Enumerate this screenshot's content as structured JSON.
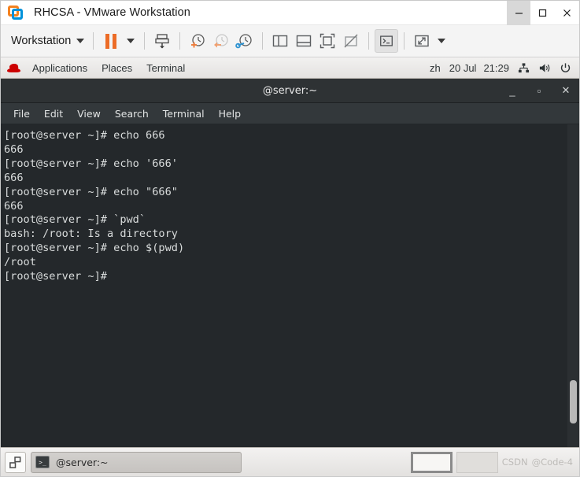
{
  "vmware": {
    "title": "RHCSA - VMware Workstation",
    "logo_icon": "vmware-logo-icon",
    "window_controls": [
      {
        "name": "minimize-button",
        "glyph": "minimize-icon"
      },
      {
        "name": "maximize-button",
        "glyph": "maximize-icon"
      },
      {
        "name": "close-button",
        "glyph": "close-icon"
      }
    ],
    "toolbar": {
      "menu_label": "Workstation",
      "buttons": [
        {
          "name": "pause-button",
          "icon": "pause-icon"
        },
        {
          "name": "pause-dropdown",
          "icon": "chevron-down-icon"
        },
        {
          "name": "power-button",
          "icon": "power-down-icon"
        },
        {
          "name": "take-snapshot-button",
          "icon": "snapshot-add-icon"
        },
        {
          "name": "revert-snapshot-button",
          "icon": "snapshot-revert-icon"
        },
        {
          "name": "snapshot-manager-button",
          "icon": "snapshot-manager-icon"
        },
        {
          "name": "show-library-button",
          "icon": "library-panel-icon"
        },
        {
          "name": "show-thumbnails-button",
          "icon": "thumbnail-bar-icon"
        },
        {
          "name": "full-screen-button",
          "icon": "fullscreen-icon"
        },
        {
          "name": "unity-mode-button",
          "icon": "unity-mode-icon"
        },
        {
          "name": "console-view-button",
          "icon": "console-prompt-icon"
        },
        {
          "name": "stretch-button",
          "icon": "stretch-arrows-icon"
        },
        {
          "name": "stretch-dropdown",
          "icon": "chevron-down-icon"
        }
      ]
    }
  },
  "gnome_topbar": {
    "logo_icon": "redhat-hat-icon",
    "items": [
      {
        "name": "applications-menu",
        "label": "Applications"
      },
      {
        "name": "places-menu",
        "label": "Places"
      },
      {
        "name": "active-app-menu",
        "label": "Terminal"
      }
    ],
    "input_source": "zh",
    "date": "20 Jul",
    "time": "21:29",
    "status_icons": [
      {
        "name": "network-icon"
      },
      {
        "name": "volume-icon"
      },
      {
        "name": "power-icon"
      }
    ]
  },
  "terminal": {
    "title": "@server:~",
    "window_controls": [
      {
        "name": "terminal-minimize-button",
        "glyph": "_"
      },
      {
        "name": "terminal-maximize-button",
        "glyph": "▫"
      },
      {
        "name": "terminal-close-button",
        "glyph": "✕"
      }
    ],
    "menus": [
      {
        "name": "menu-file",
        "label": "File"
      },
      {
        "name": "menu-edit",
        "label": "Edit"
      },
      {
        "name": "menu-view",
        "label": "View"
      },
      {
        "name": "menu-search",
        "label": "Search"
      },
      {
        "name": "menu-terminal",
        "label": "Terminal"
      },
      {
        "name": "menu-help",
        "label": "Help"
      }
    ],
    "prompt": "[root@server ~]#",
    "content": "[root@server ~]# echo 666\n666\n[root@server ~]# echo '666'\n666\n[root@server ~]# echo \"666\"\n666\n[root@server ~]# `pwd`\nbash: /root: Is a directory\n[root@server ~]# echo $(pwd)\n/root\n[root@server ~]#",
    "lines": [
      "[root@server ~]# echo 666",
      "666",
      "[root@server ~]# echo '666'",
      "666",
      "[root@server ~]# echo \"666\"",
      "666",
      "[root@server ~]# `pwd`",
      "bash: /root: Is a directory",
      "[root@server ~]# echo $(pwd)",
      "/root",
      "[root@server ~]#"
    ],
    "colors": {
      "background": "#24282b",
      "foreground": "#d9dcdc",
      "titlebar": "#2e3234",
      "menubar": "#33383b"
    }
  },
  "taskbar": {
    "show_desktop_icon": "show-desktop-icon",
    "task": {
      "icon": "terminal-icon",
      "label": "@server:~"
    },
    "workspaces": [
      {
        "name": "workspace-1",
        "current": true
      },
      {
        "name": "workspace-2",
        "current": false
      }
    ],
    "watermark": {
      "site": "CSDN",
      "user": "@Code-4"
    }
  }
}
